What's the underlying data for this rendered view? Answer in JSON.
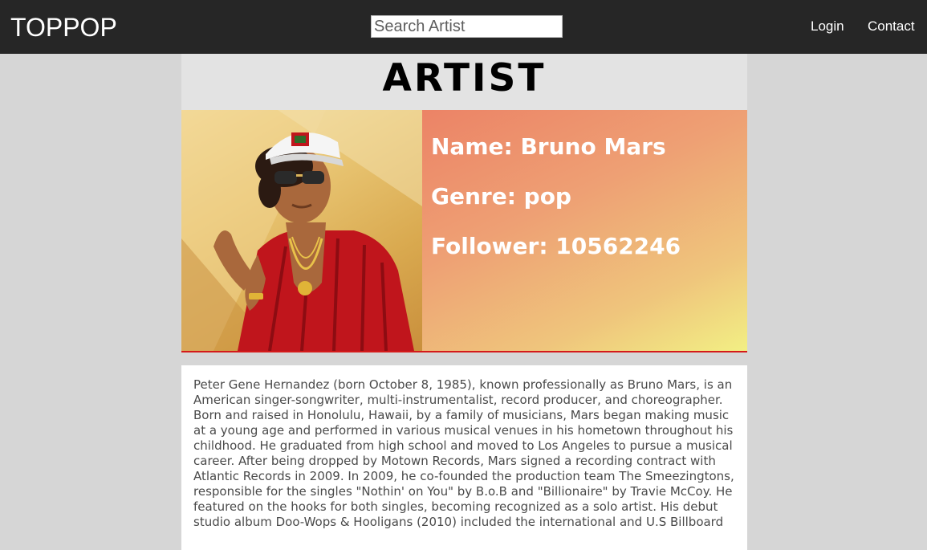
{
  "header": {
    "brand": "TOPPOP",
    "search_placeholder": "Search Artist",
    "nav": {
      "login": "Login",
      "contact": "Contact"
    }
  },
  "page_title": "ARTIST",
  "artist": {
    "name_line": "Name: Bruno Mars",
    "genre_line": "Genre: pop",
    "follower_line": "Follower: 10562246",
    "photo_icon": "artist-photo",
    "accent_color": "#d41a1a"
  },
  "bio": "Peter Gene Hernandez (born October 8, 1985), known professionally as Bruno Mars, is an American singer-songwriter, multi-instrumentalist, record producer, and choreographer. Born and raised in Honolulu, Hawaii, by a family of musicians, Mars began making music at a young age and performed in various musical venues in his hometown throughout his childhood. He graduated from high school and moved to Los Angeles to pursue a musical career. After being dropped by Motown Records, Mars signed a recording contract with Atlantic Records in 2009. In 2009, he co-founded the production team The Smeezingtons, responsible for the singles \"Nothin' on You\" by B.o.B and \"Billionaire\" by Travie McCoy. He featured on the hooks for both singles, becoming recognized as a solo artist. His debut studio album Doo-Wops & Hooligans (2010) included the international and U.S Billboard"
}
